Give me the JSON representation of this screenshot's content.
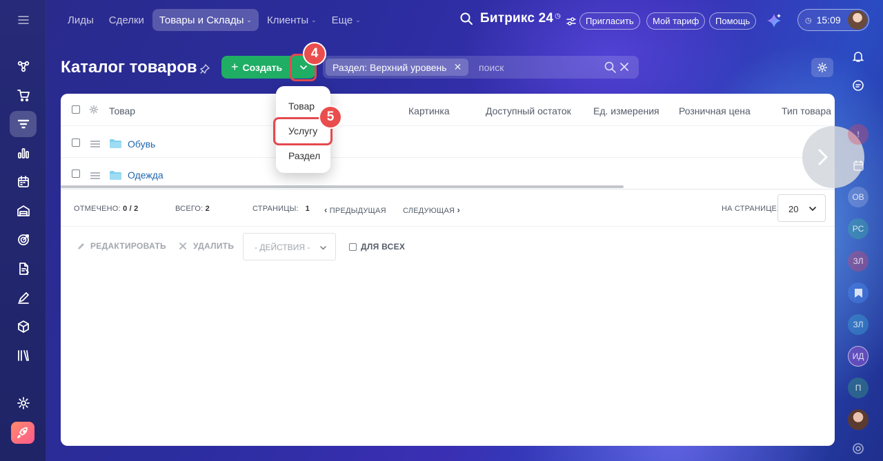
{
  "topnav": {
    "items": [
      {
        "label": "Лиды",
        "active": false,
        "dropdown": false
      },
      {
        "label": "Сделки",
        "active": false,
        "dropdown": false
      },
      {
        "label": "Товары и Склады",
        "active": true,
        "dropdown": true
      },
      {
        "label": "Клиенты",
        "active": false,
        "dropdown": true
      },
      {
        "label": "Еще",
        "active": false,
        "dropdown": true
      }
    ]
  },
  "header": {
    "brand": "Битрикс 24",
    "invite_label": "Пригласить",
    "tariff_label": "Мой тариф",
    "help_label": "Помощь",
    "time": "15:09"
  },
  "sidebar": {
    "icons": [
      "hamburger-icon",
      "crm-icon",
      "cart-icon",
      "catalog-filter-icon",
      "chart-icon",
      "calendar-task-icon",
      "warehouse-icon",
      "target-icon",
      "documents-icon",
      "sign-icon",
      "box-icon",
      "library-icon",
      "settings-icon",
      "rocket-icon"
    ],
    "active_index": 3
  },
  "page": {
    "title": "Каталог товаров",
    "create_label": "Создать",
    "filter_chip": "Раздел: Верхний уровень",
    "search_placeholder": "поиск"
  },
  "steps": {
    "dropdown_step": "4",
    "item_step": "5"
  },
  "dropdown": {
    "items": [
      "Товар",
      "Услугу",
      "Раздел"
    ],
    "highlighted_index": 1
  },
  "table": {
    "columns": [
      "Товар",
      "Картинка",
      "Доступный остаток",
      "Ед. измерения",
      "Розничная цена",
      "Тип товара"
    ],
    "rows": [
      {
        "name": "Обувь"
      },
      {
        "name": "Одежда"
      }
    ]
  },
  "footer": {
    "marked_label": "ОТМЕЧЕНО:",
    "marked_value": "0 / 2",
    "total_label": "ВСЕГО:",
    "total_value": "2",
    "pages_label": "СТРАНИЦЫ:",
    "pages_value": "1",
    "prev_label": "ПРЕДЫДУЩАЯ",
    "next_label": "СЛЕДУЮЩАЯ",
    "per_page_label": "НА СТРАНИЦЕ:",
    "per_page_value": "20"
  },
  "actions": {
    "edit_label": "РЕДАКТИРОВАТЬ",
    "delete_label": "УДАЛИТЬ",
    "actions_select": "- ДЕЙСТВИЯ -",
    "for_all_label": "ДЛЯ ВСЕХ"
  },
  "rightbar": {
    "initials": [
      "ОВ",
      "РС",
      "ЗЛ",
      "ЗЛ",
      "ИД",
      "П"
    ]
  },
  "colors": {
    "accent_green": "#1fae64",
    "highlight_red": "#e4494f",
    "link_blue": "#2067b0"
  }
}
